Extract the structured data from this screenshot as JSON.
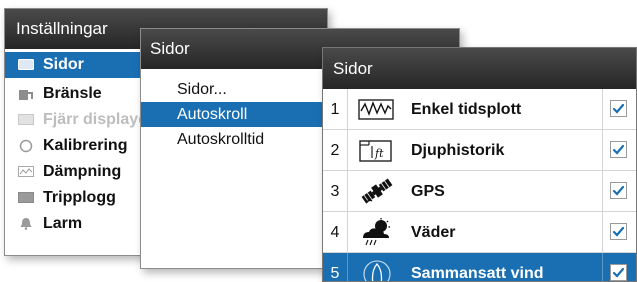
{
  "colors": {
    "titlebar": "#2f2f2f",
    "selection": "#1a6fb3",
    "check": "#1a6fb3",
    "dimmed_text": "#bdbdbd"
  },
  "settings_panel": {
    "title": "Inställningar",
    "items": [
      {
        "label": "Sidor",
        "icon": "pages-icon",
        "state": "selected"
      },
      {
        "label": "Bränsle",
        "icon": "fuel-icon",
        "state": "normal"
      },
      {
        "label": "Fjärr displaye",
        "icon": "remote-display-icon",
        "state": "dimmed"
      },
      {
        "label": "Kalibrering",
        "icon": "calibration-icon",
        "state": "normal"
      },
      {
        "label": "Dämpning",
        "icon": "damping-icon",
        "state": "normal"
      },
      {
        "label": "Tripplogg",
        "icon": "triplog-icon",
        "state": "normal"
      },
      {
        "label": "Larm",
        "icon": "alarm-bell-icon",
        "state": "normal"
      }
    ]
  },
  "pages_menu": {
    "title": "Sidor",
    "items": [
      {
        "label": "Sidor...",
        "state": "normal"
      },
      {
        "label": "Autoskroll",
        "state": "selected"
      },
      {
        "label": "Autoskrolltid",
        "state": "normal"
      }
    ]
  },
  "pages_list": {
    "title": "Sidor",
    "rows": [
      {
        "num": "1",
        "label": "Enkel tidsplott",
        "icon": "time-plot-icon",
        "checked": true,
        "selected": false
      },
      {
        "num": "2",
        "label": "Djuphistorik",
        "icon": "depth-history-icon",
        "icon_text": "ft",
        "checked": true,
        "selected": false
      },
      {
        "num": "3",
        "label": "GPS",
        "icon": "satellite-icon",
        "checked": true,
        "selected": false
      },
      {
        "num": "4",
        "label": "Väder",
        "icon": "weather-icon",
        "checked": true,
        "selected": false
      },
      {
        "num": "5",
        "label": "Sammansatt vind",
        "icon": "boat-wind-icon",
        "checked": true,
        "selected": true
      }
    ]
  }
}
